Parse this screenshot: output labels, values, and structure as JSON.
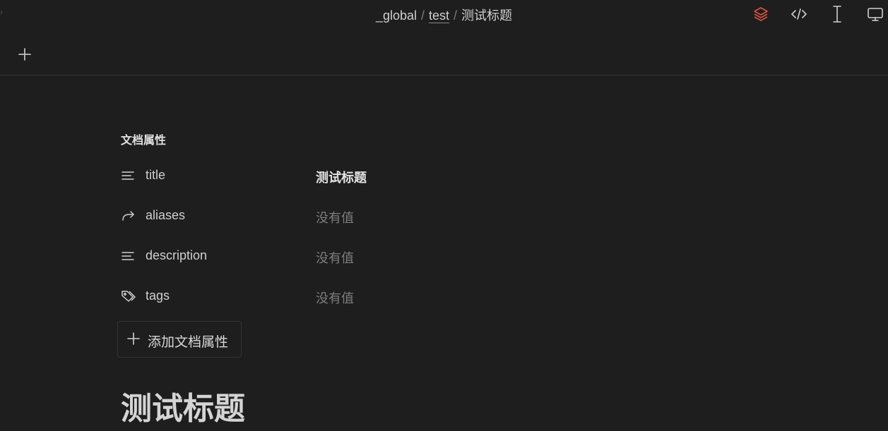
{
  "breadcrumb": {
    "items": [
      "_global",
      "test",
      "测试标题"
    ],
    "separator": "/"
  },
  "toolbar": {
    "icons": [
      "layers-icon",
      "code-icon",
      "text-cursor-icon",
      "monitor-icon"
    ],
    "accent_color": "#d9543f"
  },
  "tabs": {
    "add_icon": "plus-icon"
  },
  "properties": {
    "section_title": "文档属性",
    "rows": [
      {
        "key": "title",
        "icon": "text-lines-icon",
        "value": "测试标题"
      },
      {
        "key": "aliases",
        "icon": "forward-arrow-icon",
        "value": "没有值"
      },
      {
        "key": "description",
        "icon": "text-lines-icon",
        "value": "没有值"
      },
      {
        "key": "tags",
        "icon": "tag-icon",
        "value": "没有值"
      }
    ],
    "add_label": "添加文档属性"
  },
  "document": {
    "heading": "测试标题"
  }
}
